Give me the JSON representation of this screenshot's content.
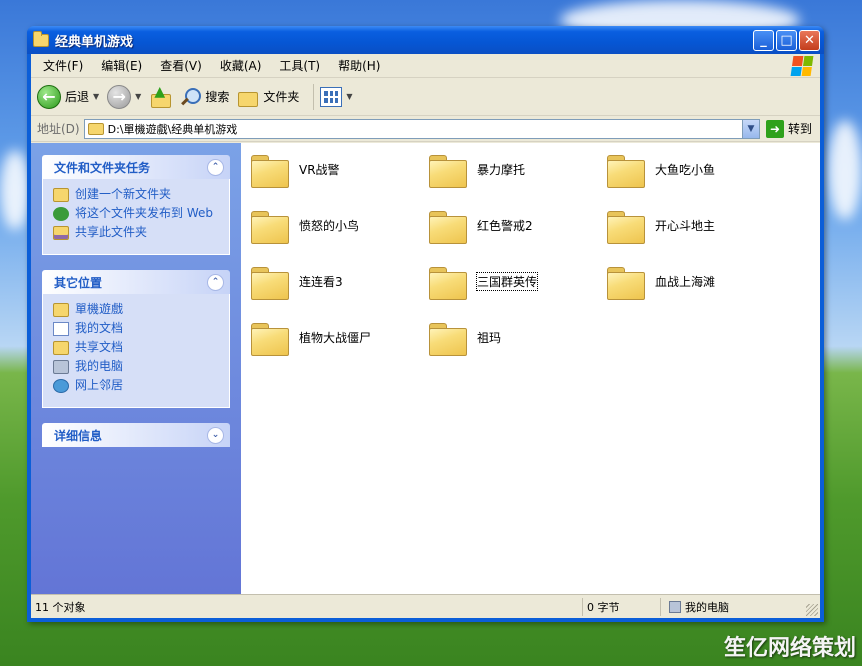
{
  "window": {
    "title": "经典单机游戏",
    "minimize_glyph": "_",
    "maximize_glyph": "□",
    "close_glyph": "✕"
  },
  "menu": {
    "items": [
      "文件(F)",
      "编辑(E)",
      "查看(V)",
      "收藏(A)",
      "工具(T)",
      "帮助(H)"
    ]
  },
  "toolbar": {
    "back_label": "后退",
    "search_label": "搜索",
    "folders_label": "文件夹"
  },
  "address": {
    "label": "地址(D)",
    "path": "D:\\單機遊戲\\经典单机游戏",
    "go_label": "转到"
  },
  "taskpane": {
    "file_tasks": {
      "title": "文件和文件夹任务",
      "items": [
        "创建一个新文件夹",
        "将这个文件夹发布到 Web",
        "共享此文件夹"
      ]
    },
    "other_places": {
      "title": "其它位置",
      "items": [
        "單機遊戲",
        "我的文档",
        "共享文档",
        "我的电脑",
        "网上邻居"
      ]
    },
    "details": {
      "title": "详细信息"
    }
  },
  "files": [
    "VR战警",
    "暴力摩托",
    "大鱼吃小鱼",
    "愤怒的小鸟",
    "红色警戒2",
    "开心斗地主",
    "连连看3",
    "三国群英传",
    "血战上海滩",
    "植物大战僵尸",
    "祖玛"
  ],
  "status": {
    "object_count": "11 个对象",
    "size": "0 字节",
    "location": "我的电脑"
  },
  "watermark": "笙亿网络策划"
}
